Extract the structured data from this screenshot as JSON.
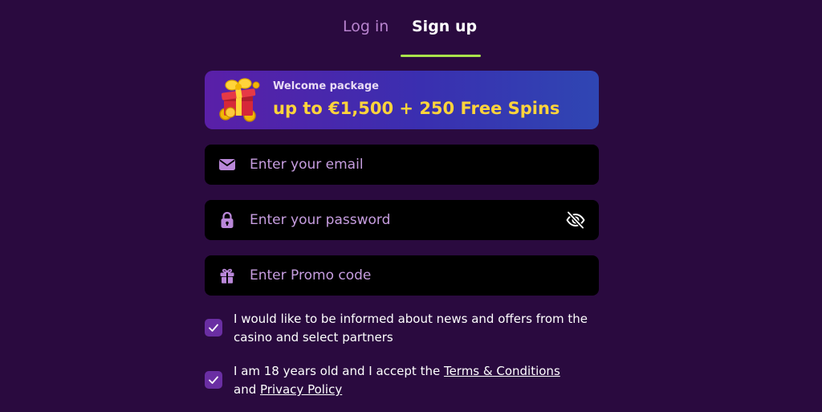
{
  "tabs": {
    "login_label": "Log in",
    "signup_label": "Sign up",
    "active": "Sign up"
  },
  "banner": {
    "subtitle": "Welcome package",
    "title": "up to €1,500 + 250 Free Spins",
    "icon": "gift-box-icon"
  },
  "form": {
    "email": {
      "placeholder": "Enter your email",
      "value": "",
      "icon": "envelope-icon"
    },
    "password": {
      "placeholder": "Enter your password",
      "value": "",
      "icon": "lock-icon",
      "toggle_icon": "eye-off-icon"
    },
    "promo": {
      "placeholder": "Enter Promo code",
      "value": "",
      "icon": "gift-icon"
    }
  },
  "consents": {
    "news": {
      "checked": true,
      "text": "I would like to be informed about news and offers from the casino and select partners"
    },
    "age": {
      "checked": true,
      "text_before": "I am 18 years old and I accept the ",
      "terms_link": "Terms & Conditions",
      "text_middle": " and ",
      "privacy_link": "Privacy Policy"
    }
  },
  "colors": {
    "background": "#2a0a3f",
    "accent_underline": "#a9e34b",
    "banner_highlight": "#ffd43b",
    "placeholder": "#c79ee0",
    "checkbox": "#6a2ea3",
    "inactive_tab": "#b883cf"
  }
}
